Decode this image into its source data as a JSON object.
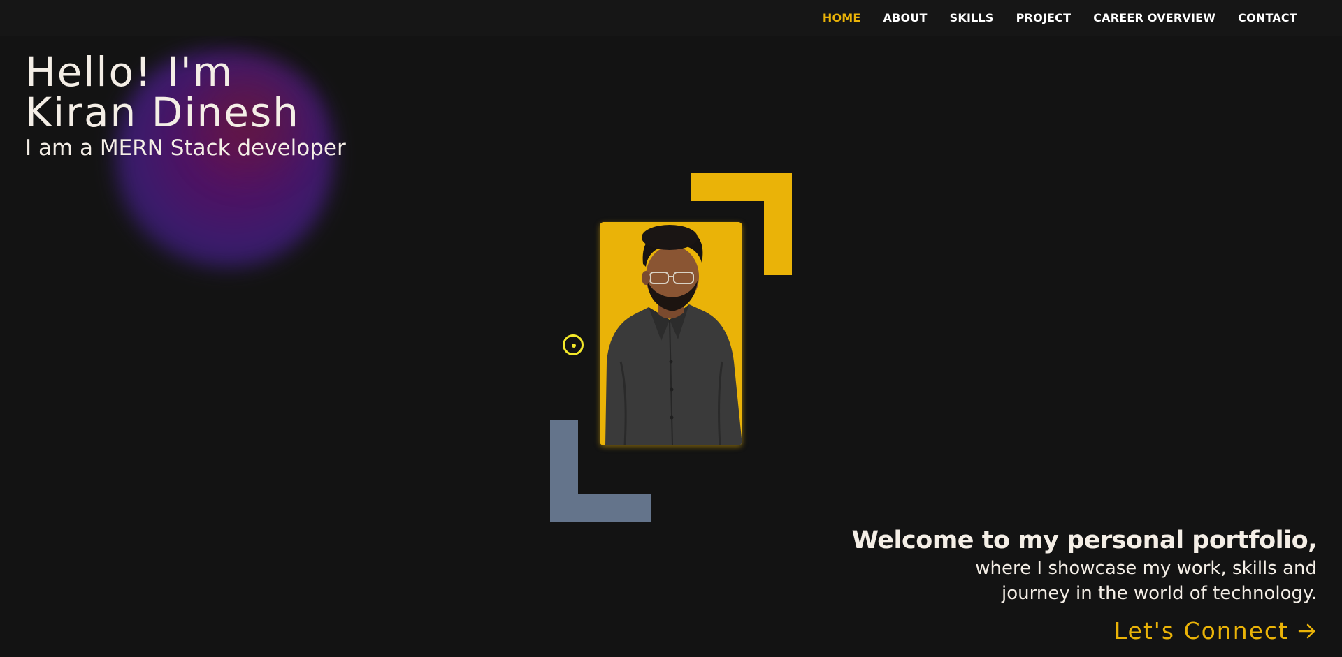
{
  "nav": {
    "items": [
      {
        "label": "HOME",
        "active": true
      },
      {
        "label": "ABOUT",
        "active": false
      },
      {
        "label": "SKILLS",
        "active": false
      },
      {
        "label": "PROJECT",
        "active": false
      },
      {
        "label": "CAREER OVERVIEW",
        "active": false
      },
      {
        "label": "CONTACT",
        "active": false
      }
    ]
  },
  "hero": {
    "title_line1": "Hello! I'm",
    "title_line2": "Kiran Dinesh",
    "subtitle": "I am a MERN Stack developer"
  },
  "welcome": {
    "heading": "Welcome to my personal portfolio,",
    "line1": "where I showcase my work, skills and",
    "line2": "journey in the world of technology."
  },
  "cta": {
    "label": "Let's Connect",
    "icon": "arrow-right-icon"
  },
  "colors": {
    "background": "#131313",
    "accent": "#eab308",
    "frame_secondary": "#64748b",
    "text": "#f4eee6",
    "cursor": "#f3e82a"
  }
}
